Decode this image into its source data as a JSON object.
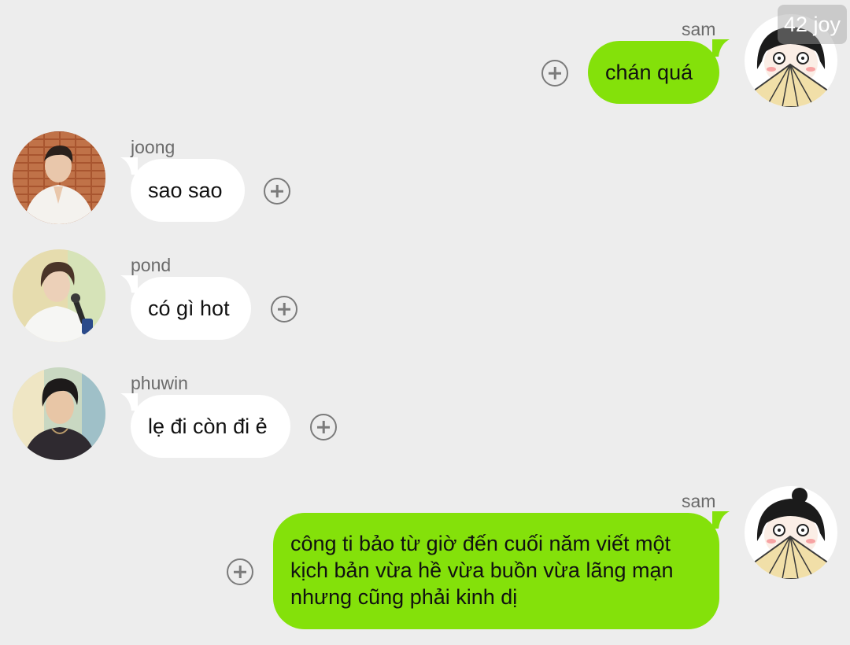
{
  "watermark": "42 joy",
  "messages": [
    {
      "sender": "sam",
      "text": "chán quá",
      "outgoing": true
    },
    {
      "sender": "joong",
      "text": "sao sao",
      "outgoing": false
    },
    {
      "sender": "pond",
      "text": "có gì hot",
      "outgoing": false
    },
    {
      "sender": "phuwin",
      "text": "lẹ đi còn đi ẻ",
      "outgoing": false
    },
    {
      "sender": "sam",
      "text_lines": [
        "công ti bảo từ giờ đến cuối năm viết một",
        "kịch bản vừa hề vừa buồn vừa lãng mạn",
        "nhưng cũng phải kinh dị"
      ],
      "outgoing": true
    }
  ],
  "colors": {
    "background": "#ededed",
    "outgoing_bubble": "#84e10a",
    "incoming_bubble": "#ffffff",
    "name_text": "#6b6b6b"
  },
  "icons": {
    "add": "plus-circle-icon"
  }
}
